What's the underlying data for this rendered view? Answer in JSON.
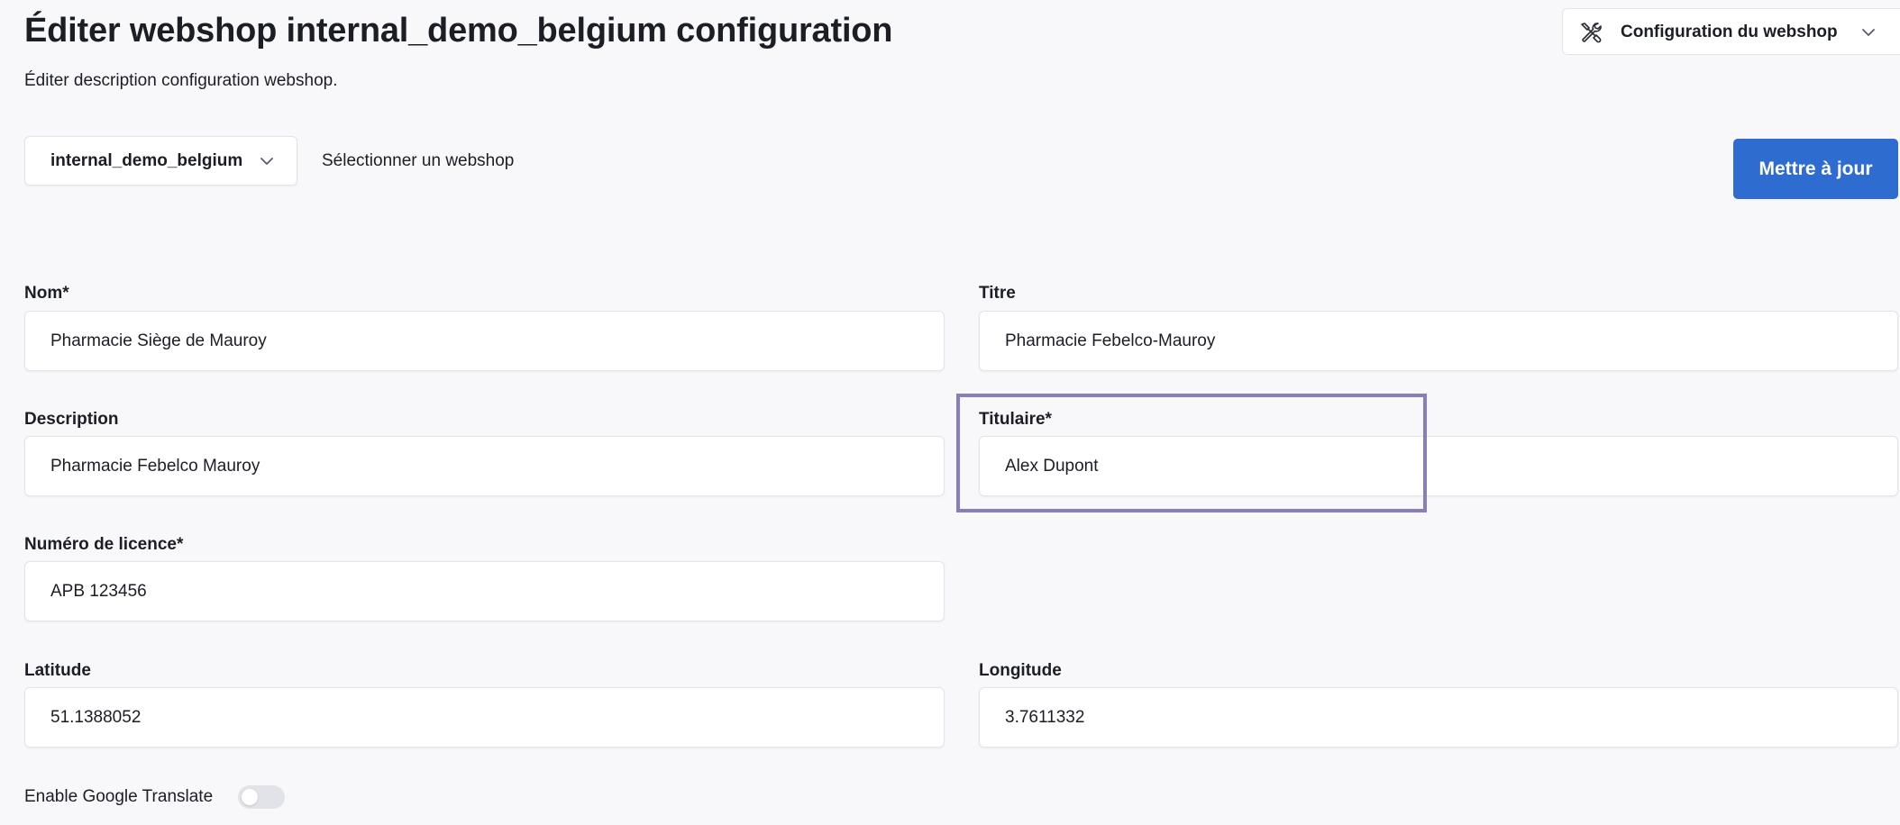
{
  "header": {
    "title": "Éditer webshop internal_demo_belgium configuration",
    "subtitle": "Éditer description configuration webshop."
  },
  "config_menu": {
    "label": "Configuration du webshop",
    "icon": "tools-icon"
  },
  "webshop_selector": {
    "selected": "internal_demo_belgium",
    "hint": "Sélectionner un webshop"
  },
  "actions": {
    "update_label": "Mettre à jour",
    "update_color": "#2f6ccf"
  },
  "form": {
    "nom": {
      "label": "Nom*",
      "value": "Pharmacie Siège de Mauroy"
    },
    "titre": {
      "label": "Titre",
      "value": "Pharmacie Febelco-Mauroy"
    },
    "description": {
      "label": "Description",
      "value": "Pharmacie Febelco Mauroy"
    },
    "titulaire": {
      "label": "Titulaire*",
      "value": "Alex Dupont"
    },
    "licence": {
      "label": "Numéro de licence*",
      "value": "APB 123456"
    },
    "latitude": {
      "label": "Latitude",
      "value": "51.1388052"
    },
    "longitude": {
      "label": "Longitude",
      "value": "3.7611332"
    },
    "google_translate": {
      "label": "Enable Google Translate",
      "enabled": false
    }
  },
  "highlight_color": "#8a7dbd"
}
